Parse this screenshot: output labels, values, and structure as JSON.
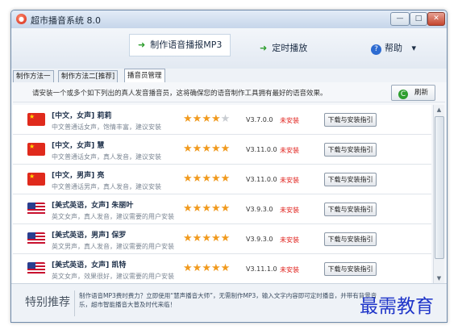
{
  "window": {
    "title": "超市播音系统 8.0",
    "controls": {
      "minimize": "—",
      "maximize": "□",
      "close": "✕"
    }
  },
  "toolbar": {
    "make_mp3": "制作语音播报MP3",
    "timed_play": "定时播放",
    "help": "帮助",
    "help_dropdown": "▾",
    "arrow_glyph": "➜"
  },
  "tabs": [
    {
      "label": "制作方法一"
    },
    {
      "label": "制作方法二[推荐]"
    },
    {
      "label": "播音员管理"
    }
  ],
  "notice": "请安装一个或多个如下列出的真人发音播音员，这将确保您的语音制作工具拥有最好的语音效果。",
  "refresh_label": "刷新",
  "voices": [
    {
      "name": "[中文，女声] 莉莉",
      "desc": "中文普通话女声，饱情丰富，建议安装",
      "flag": "cn",
      "rating": 4,
      "version": "V3.7.0.0",
      "status": "未安装",
      "button": "下载与安装指引"
    },
    {
      "name": "[中文，女声] 慧",
      "desc": "中文普通话女声，真人发音，建议安装",
      "flag": "cn",
      "rating": 5,
      "version": "V3.11.0.0",
      "status": "未安装",
      "button": "下载与安装指引"
    },
    {
      "name": "[中文，男声] 亮",
      "desc": "中文普通话男声，真人发音，建议安装",
      "flag": "cn",
      "rating": 5,
      "version": "V3.11.0.0",
      "status": "未安装",
      "button": "下载与安装指引"
    },
    {
      "name": "[美式英语，女声] 朱丽叶",
      "desc": "英文女声，真人发音，建议需要的用户安装",
      "flag": "us",
      "rating": 5,
      "version": "V3.9.3.0",
      "status": "未安装",
      "button": "下载与安装指引"
    },
    {
      "name": "[美式英语，男声] 保罗",
      "desc": "英文男声，真人发音，建议需要的用户安装",
      "flag": "us",
      "rating": 5,
      "version": "V3.9.3.0",
      "status": "未安装",
      "button": "下载与安装指引"
    },
    {
      "name": "[美式英语，女声] 凯特",
      "desc": "英文女声，效果很好，建议需要的用户安装",
      "flag": "us",
      "rating": 5,
      "version": "V3.11.1.0",
      "status": "未安装",
      "button": "下载与安装指引"
    }
  ],
  "promo": {
    "title": "特别推荐",
    "text": "制作语音MP3费时费力？立即使用“慧声播音大师”，无需制作MP3，输入文字内容即可定时播音，并带有背景音乐，超市智能播音大普及时代来临！"
  },
  "watermark": "最需教育",
  "colors": {
    "accent_green": "#2e9e2e",
    "status_red": "#e0201b",
    "star_gold": "#f19a1e",
    "watermark_blue": "#1f35c9"
  }
}
